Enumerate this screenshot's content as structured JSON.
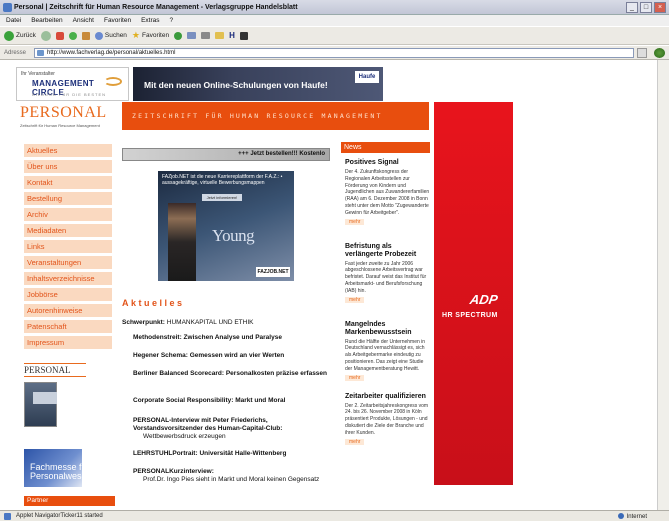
{
  "browser": {
    "title": "Personal | Zeitschrift für Human Resource Management - Verlagsgruppe Handelsblatt",
    "menu": [
      "Datei",
      "Bearbeiten",
      "Ansicht",
      "Favoriten",
      "Extras",
      "?"
    ],
    "toolbar": {
      "back": "Zurück",
      "search": "Suchen",
      "favorites": "Favoriten"
    },
    "address_label": "Adresse",
    "address": "http://www.fachverlag.de/personal/aktuelles.html",
    "status": "Applet NavigatorTicker11 started",
    "zone": "Internet"
  },
  "page": {
    "mc_logo": {
      "line1": "Ihr Veranstalter",
      "line2": "MANAGEMENT CIRCLE",
      "line3": "BILDUNG FÜR DIE BESTEN"
    },
    "haufe_banner": "Mit den neuen Online-Schulungen von Haufe!",
    "haufe_logo": "Haufe",
    "brand": "PERSONAL",
    "brand_sub": "Zeitschrift für Human Resource Management",
    "tagline": "ZEITSCHRIFT FÜR HUMAN RESOURCE MANAGEMENT",
    "nav": [
      "Aktuelles",
      "Über uns",
      "Kontakt",
      "Bestellung",
      "Archiv",
      "Mediadaten",
      "Links",
      "Veranstaltungen",
      "Inhaltsverzeichnisse",
      "Jobbörse",
      "Autorenhinweise",
      "Patenschaft",
      "Impressum"
    ],
    "side_brand": "PERSONAL",
    "fachmesse": "Fachmesse für Personalwesen",
    "partner": "Partner",
    "bestellen": "+++ Jetzt bestellen!!! Kostenlo",
    "ad": {
      "top": "FAZjob.NET ist die neue Karriereplattform der F.A.Z.: • aussagekräftige, virtuelle Bewerbungsmappen",
      "button": "Jetzt informieren!",
      "big": "Young",
      "faz": "FAZJOB.NET"
    },
    "section_title": "Aktuelles",
    "schwerpunkt_label": "Schwerpunkt:",
    "schwerpunkt_value": "HUMANKAPITAL UND ETHIK",
    "articles": [
      {
        "h": "Methodenstreit: Zwischen Analyse und Paralyse",
        "d": ""
      },
      {
        "h": "Hegener Schema: Gemessen wird an vier Werten",
        "d": ""
      },
      {
        "h": "Berliner Balanced Scorecard: Personalkosten präzise erfassen",
        "d": ""
      },
      {
        "h": "Corporate Social Responsibility: Markt und Moral",
        "d": ""
      },
      {
        "h": "PERSONAL-Interview mit Peter Friederichs, Vorstandsvorsitzender des Human-Capital-Club:",
        "d": "Wettbewerbsdruck erzeugen"
      },
      {
        "h": "LEHRSTUHLPortrait: Universität Halle-Wittenberg",
        "d": ""
      },
      {
        "h": "PERSONALKurzinterview:",
        "d": "Prof.Dr. Ingo Pies sieht in Markt und Moral keinen Gegensatz"
      }
    ],
    "news_title": "News",
    "news": [
      {
        "h": "Positives Signal",
        "b": "Der 4. Zukunftskongress der Regionalen Arbeitsstellen zur Förderung von Kindern und Jugendlichen aus Zuwandererfamilien (RAA) am 6. Dezember 2008 in Bonn steht unter dem Motto \"Zugewanderte Gewinn für Arbeitgeber\".",
        "m": "mehr"
      },
      {
        "h": "Befristung als verlängerte Probezeit",
        "b": "Fast jeder zweite zu Jahr 2006 abgeschlossene Arbeitsvertrag war befristet. Darauf weist das Institut für Arbeitsmarkt- und Berufsforschung (IAB) hin.",
        "m": "mehr"
      },
      {
        "h": "Mangelndes Markenbewusstsein",
        "b": "Rund die Hälfte der Unternehmen in Deutschland vernachlässigt es, sich als Arbeitgebermarke eindeutig zu positionieren. Das zeigt eine Studie der Managementberatung Hewitt.",
        "m": "mehr"
      },
      {
        "h": "Zeitarbeiter qualifizieren",
        "b": "Der 2. Zeitarbeitsjahreskongress vom 24. bis 26. November 2008 in Köln präsentiert Produkte, Lösungen - und diskutiert die Ziele der Branche und ihrer Kunden.",
        "m": "mehr"
      }
    ],
    "adp": {
      "logo": "ADP",
      "text": "HR SPECTRUM"
    }
  }
}
